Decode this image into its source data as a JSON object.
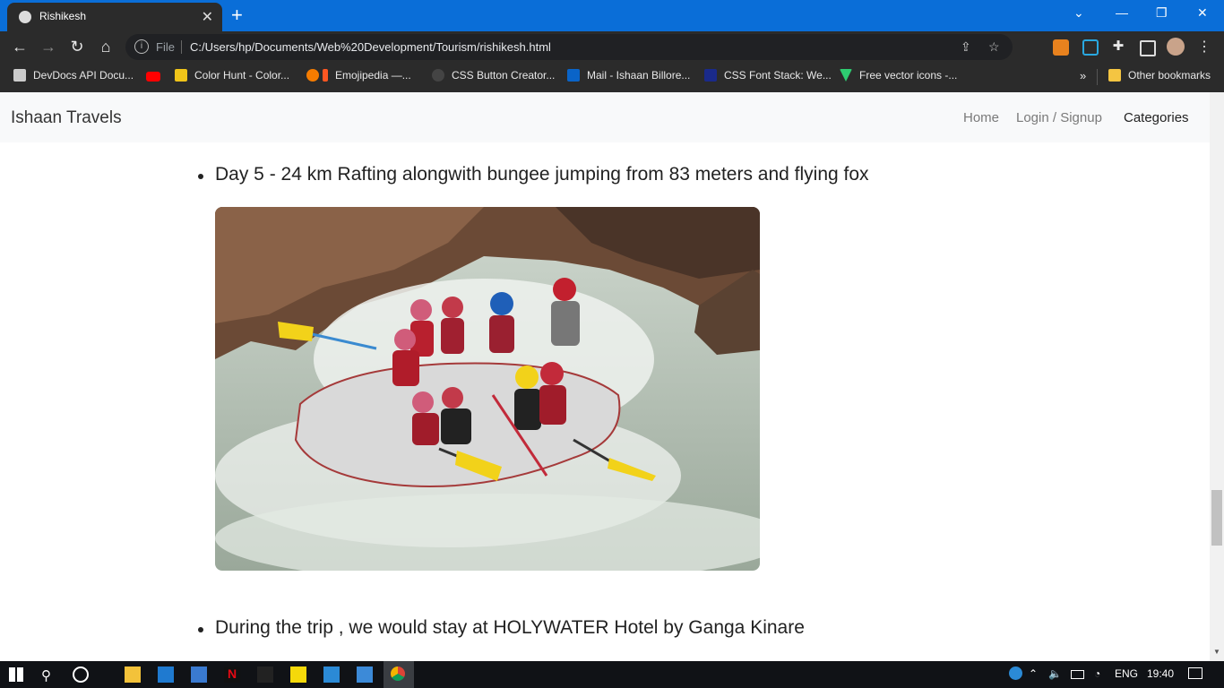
{
  "browser": {
    "tab_title": "Rishikesh",
    "address": {
      "scheme_label": "File",
      "url": "C:/Users/hp/Documents/Web%20Development/Tourism/rishikesh.html"
    },
    "bookmarks": [
      {
        "label": "DevDocs API Docu...",
        "icon": "devdocs-icon",
        "color": "#cccccc"
      },
      {
        "label": "",
        "icon": "youtube-icon",
        "color": "#ff0000"
      },
      {
        "label": "Color Hunt - Color...",
        "icon": "colorhunt-icon",
        "color": "#f0c419"
      },
      {
        "label": "Emojipedia —...",
        "icon": "emojipedia-icon",
        "color": "#f57c00"
      },
      {
        "label": "CSS Button Creator...",
        "icon": "gear-icon",
        "color": "#444444"
      },
      {
        "label": "Mail - Ishaan Billore...",
        "icon": "outlook-icon",
        "color": "#0a64c8"
      },
      {
        "label": "CSS Font Stack: We...",
        "icon": "cssfont-icon",
        "color": "#1a2a8a"
      },
      {
        "label": "Free vector icons -...",
        "icon": "vector-icon",
        "color": "#2ecc71"
      }
    ],
    "other_bookmarks_label": "Other bookmarks"
  },
  "site": {
    "brand": "Ishaan Travels",
    "nav": {
      "home": "Home",
      "login": "Login / Signup",
      "categories": "Categories"
    }
  },
  "content": {
    "item1": "Day 5 - 24 km Rafting alongwith bungee jumping from 83 meters and flying fox",
    "item2": "During the trip , we would stay at HOLYWATER Hotel by Ganga Kinare"
  },
  "taskbar": {
    "language": "ENG",
    "time": "19:40"
  },
  "colors": {
    "title_bar": "#0a6ed8",
    "toolbar": "#2b2b2b",
    "navbar_bg": "#f8f9fa",
    "taskbar": "#101216"
  }
}
